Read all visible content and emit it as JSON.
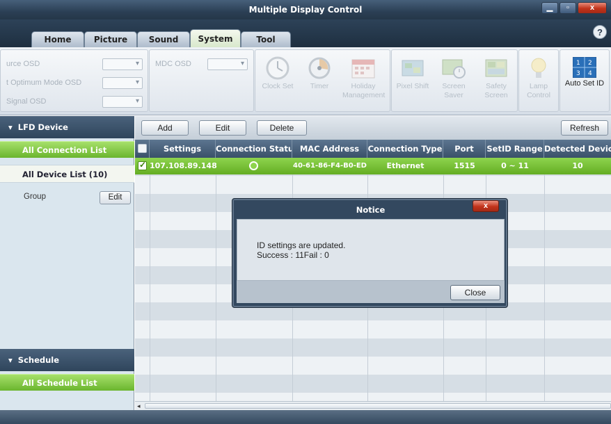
{
  "window": {
    "title": "Multiple Display Control",
    "controls": [
      "minimize",
      "maximize",
      "close"
    ]
  },
  "tabs": [
    {
      "label": "Home",
      "active": false
    },
    {
      "label": "Picture",
      "active": false
    },
    {
      "label": "Sound",
      "active": false
    },
    {
      "label": "System",
      "active": true
    },
    {
      "label": "Tool",
      "active": false
    }
  ],
  "help_label": "?",
  "ribbon": {
    "osd": [
      {
        "label": "urce OSD",
        "value": ""
      },
      {
        "label": "t Optimum Mode OSD",
        "value": ""
      },
      {
        "label": "Signal OSD",
        "value": ""
      }
    ],
    "mdc_osd": {
      "label": "MDC OSD",
      "value": ""
    },
    "buttons": [
      {
        "label": "Clock Set",
        "enabled": false
      },
      {
        "label": "Timer",
        "enabled": false
      },
      {
        "label": "Holiday Management",
        "enabled": false
      },
      {
        "label": "Pixel Shift",
        "enabled": false
      },
      {
        "label": "Screen Saver",
        "enabled": false
      },
      {
        "label": "Safety Screen",
        "enabled": false
      },
      {
        "label": "Lamp Control",
        "enabled": false
      },
      {
        "label": "Auto Set ID",
        "enabled": true
      }
    ],
    "auto_set_id_numbers": [
      "1",
      "2",
      "3",
      "4"
    ]
  },
  "left_panel": {
    "lfd_header": "LFD Device",
    "all_connection_list": "All Connection List",
    "all_device_list": "All Device List (10)",
    "group_label": "Group",
    "group_edit_label": "Edit",
    "schedule_header": "Schedule",
    "all_schedule_list": "All Schedule List"
  },
  "toolbar": {
    "add_label": "Add",
    "edit_label": "Edit",
    "delete_label": "Delete",
    "refresh_label": "Refresh"
  },
  "table": {
    "headers": [
      "Settings",
      "Connection Status",
      "MAC Address",
      "Connection Type",
      "Port",
      "SetID Range",
      "Detected Devices"
    ],
    "rows": [
      {
        "checked": true,
        "settings": "107.108.89.148",
        "connection_status": "connected",
        "mac_address": "40-61-86-F4-B0-ED",
        "connection_type": "Ethernet",
        "port": "1515",
        "setid_range": "0 ~ 11",
        "detected_devices": "10"
      }
    ]
  },
  "dialog": {
    "title": "Notice",
    "close_icon_label": "x",
    "message_line1": "ID settings are updated.",
    "message_line2": "Success : 11Fail :  0",
    "close_button_label": "Close"
  },
  "colors": {
    "accent_green": "#7cc43c",
    "header_dark": "#34495f",
    "close_red": "#c2331b"
  }
}
